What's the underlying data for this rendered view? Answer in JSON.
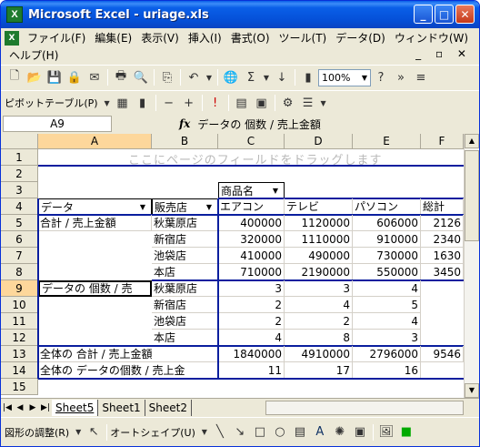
{
  "window": {
    "title": "Microsoft Excel - uriage.xls",
    "app_icon": "excel-icon"
  },
  "menu": {
    "items": [
      "ファイル(F)",
      "編集(E)",
      "表示(V)",
      "挿入(I)",
      "書式(O)",
      "ツール(T)",
      "データ(D)",
      "ウィンドウ(W)",
      "ヘルプ(H)"
    ]
  },
  "toolbar": {
    "zoom": "100%"
  },
  "pivot_toolbar": {
    "label": "ピボットテーブル(P)"
  },
  "formula_bar": {
    "name_box": "A9",
    "fx": "fx",
    "content": "データの 個数 / 売上金額"
  },
  "columns": [
    "A",
    "B",
    "C",
    "D",
    "E",
    "F"
  ],
  "rows": [
    "1",
    "2",
    "3",
    "4",
    "5",
    "6",
    "7",
    "8",
    "9",
    "10",
    "11",
    "12",
    "13",
    "14",
    "15"
  ],
  "pivot": {
    "page_drop_hint": "ここにページのフィールドをドラッグします",
    "column_field": "商品名",
    "row_field_data": "データ",
    "row_field_store": "販売店",
    "col_headers": [
      "エアコン",
      "テレビ",
      "パソコン",
      "総計"
    ],
    "sum_label": "合計 / 売上金額",
    "count_label": "データの 個数 / 売",
    "stores": [
      "秋葉原店",
      "新宿店",
      "池袋店",
      "本店"
    ],
    "sum_rows": [
      [
        "400000",
        "1120000",
        "606000",
        "2126"
      ],
      [
        "320000",
        "1110000",
        "910000",
        "2340"
      ],
      [
        "410000",
        "490000",
        "730000",
        "1630"
      ],
      [
        "710000",
        "2190000",
        "550000",
        "3450"
      ]
    ],
    "count_rows": [
      [
        "3",
        "3",
        "4",
        ""
      ],
      [
        "2",
        "4",
        "5",
        ""
      ],
      [
        "2",
        "2",
        "4",
        ""
      ],
      [
        "4",
        "8",
        "3",
        ""
      ]
    ],
    "total_sum_label": "全体の 合計 / 売上金額",
    "total_sum": [
      "1840000",
      "4910000",
      "2796000",
      "9546"
    ],
    "total_count_label": "全体の データの個数 / 売上金",
    "total_count": [
      "11",
      "17",
      "16",
      ""
    ]
  },
  "sheets": {
    "tabs": [
      "Sheet5",
      "Sheet1",
      "Sheet2"
    ],
    "active": "Sheet5"
  },
  "draw_toolbar": {
    "adjust": "図形の調整(R)",
    "autoshape": "オートシェイプ(U)"
  }
}
